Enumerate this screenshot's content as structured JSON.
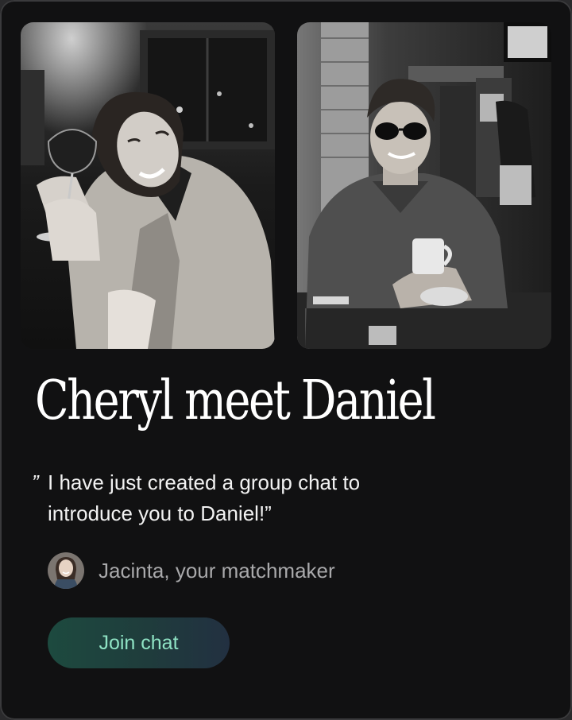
{
  "card": {
    "title": "Cheryl meet Daniel",
    "quote_open": "”",
    "quote_line1": "I have just created a group chat to",
    "quote_line2": "introduce you to Daniel!”",
    "author": "Jacinta, your matchmaker",
    "join_button_label": "Join chat"
  },
  "photos": {
    "left": "cheryl-photo",
    "right": "daniel-photo"
  },
  "colors": {
    "card_background": "#111112",
    "button_text": "#8fe3c4",
    "button_gradient_start": "#1d4a3f",
    "button_gradient_end": "#223041",
    "author_text": "#a9a9ab"
  }
}
